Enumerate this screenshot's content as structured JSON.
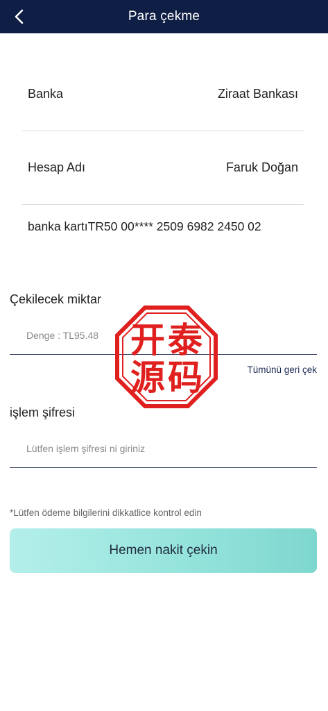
{
  "header": {
    "title": "Para çekme",
    "back_icon": "chevron-left-icon"
  },
  "bank_info": {
    "bank_label": "Banka",
    "bank_value": "Ziraat Bankası",
    "account_name_label": "Hesap Adı",
    "account_name_value": "Faruk Doğan",
    "card_text": "banka kartıTR50 00**** 2509 6982 2450 02"
  },
  "withdraw": {
    "amount_label": "Çekilecek miktar",
    "amount_placeholder": "Denge : TL95.48",
    "withdraw_all_label": "Tümünü geri çek",
    "password_label": "işlem şifresi",
    "password_placeholder": "Lütfen işlem şifresi ni giriniz",
    "hint": "*Lütfen ödeme bilgilerini dikkatlice kontrol edin",
    "submit_label": "Hemen nakit çekin"
  },
  "watermark": {
    "text": "开泰源码",
    "color": "#e0201e"
  },
  "colors": {
    "header_bg": "#0f1e45",
    "button_gradient_start": "#b4efea",
    "button_gradient_end": "#7ed7cf"
  }
}
